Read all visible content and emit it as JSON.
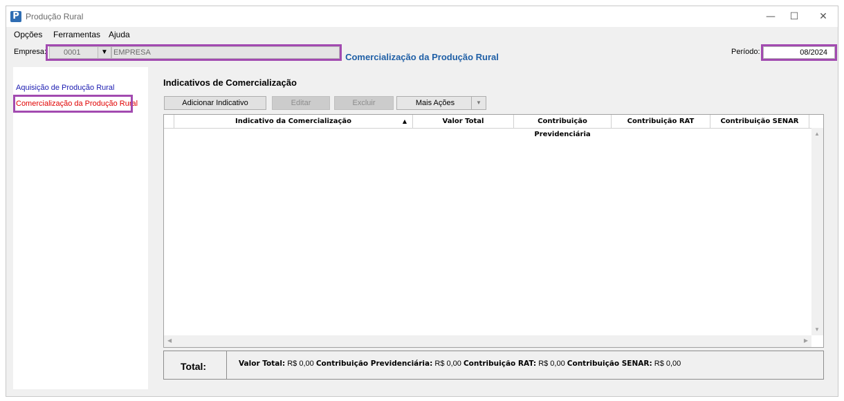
{
  "window": {
    "title": "Produção Rural",
    "icon_letter": "P",
    "controls": {
      "minimize": "—",
      "maximize": "☐",
      "close": "✕"
    }
  },
  "menu": {
    "items": [
      {
        "label": "Opções"
      },
      {
        "label": "Ferramentas"
      },
      {
        "label": "Ajuda"
      }
    ]
  },
  "empresa": {
    "label": "Empresa:",
    "code": "0001",
    "name": "EMPRESA",
    "arrow": "▼"
  },
  "page_title": "Comercialização da Produção Rural",
  "periodo": {
    "label": "Período:",
    "value": "08/2024"
  },
  "sidebar": {
    "items": [
      {
        "label": "Aquisição de Produção Rural",
        "color": "#1a1ab0"
      },
      {
        "label": "Comercialização da Produção Rural",
        "color": "#e00000"
      }
    ]
  },
  "section": {
    "title": "Indicativos de Comercialização"
  },
  "toolbar": {
    "add_label": "Adicionar Indicativo",
    "edit_label": "Editar",
    "delete_label": "Excluir",
    "more_label": "Mais Ações"
  },
  "grid": {
    "columns": [
      {
        "label": "Indicativo da Comercialização",
        "sort": "▲"
      },
      {
        "label": "Valor Total"
      },
      {
        "label": "Contribuição Previdenciária"
      },
      {
        "label": "Contribuição RAT"
      },
      {
        "label": "Contribuição SENAR"
      }
    ],
    "rows": []
  },
  "totals": {
    "label": "Total:",
    "valor_total_label": "Valor Total:",
    "valor_total": "R$ 0,00",
    "prev_label": "Contribuição Previdenciária:",
    "prev": "R$ 0,00",
    "rat_label": "Contribuição RAT:",
    "rat": "R$ 0,00",
    "senar_label": "Contribuição SENAR:",
    "senar": "R$ 0,00"
  },
  "colors": {
    "highlight": "#a24ab0",
    "title_blue": "#1f5fa6"
  }
}
